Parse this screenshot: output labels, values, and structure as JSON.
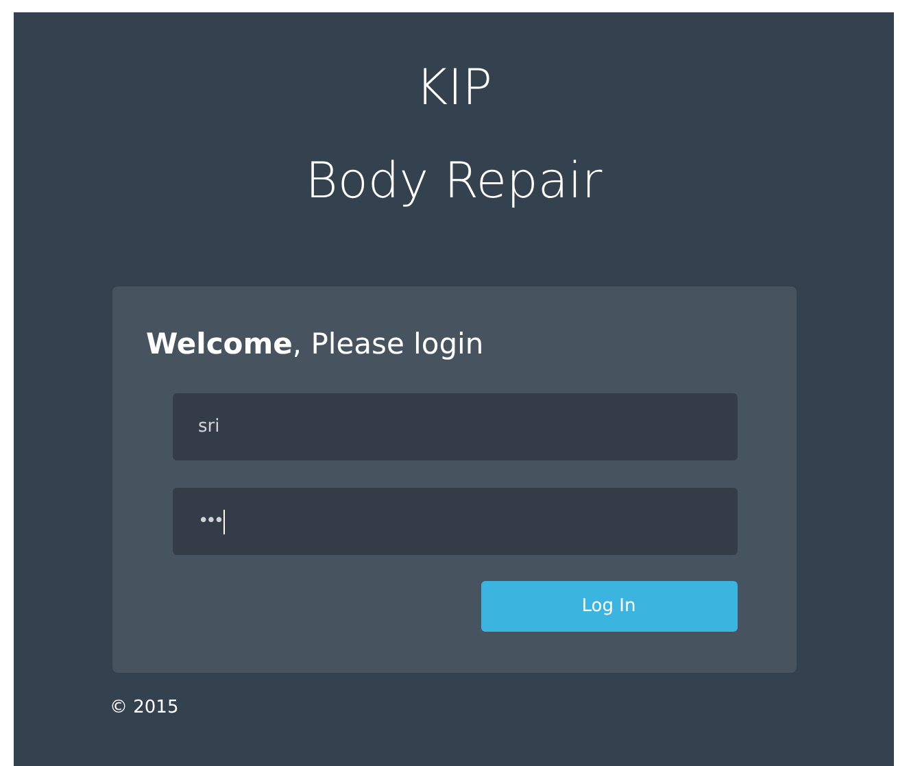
{
  "header": {
    "title_lines": [
      "KIP",
      "Body Repair"
    ]
  },
  "login": {
    "heading": "**Welcome**, Please login",
    "fields": [
      {
        "kind": "text",
        "value": "sri",
        "focused": false
      },
      {
        "kind": "password",
        "value": "•••",
        "focused": true
      }
    ],
    "button": "Log In"
  },
  "footer": "© 2015"
}
